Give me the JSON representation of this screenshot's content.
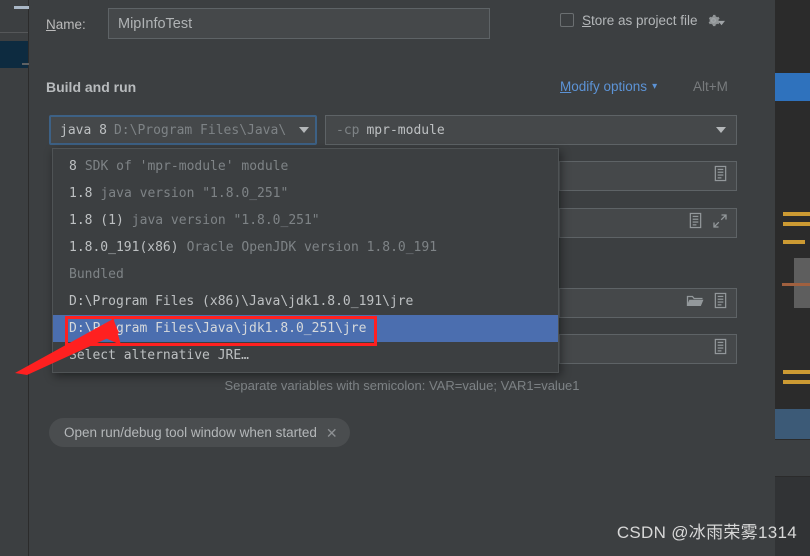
{
  "dialog": {
    "name_label": "Name:",
    "name_value": "MipInfoTest",
    "store_as_project_file": "Store as project file",
    "gear_icon": "gear-icon",
    "section_title": "Build and run",
    "modify_options": "Modify options",
    "modify_options_shortcut": "Alt+M",
    "chevron_icon": "chevron-down-icon"
  },
  "jdk_combo": {
    "name": "java 8",
    "path": "D:\\Program Files\\Java\\",
    "dropdown_icon": "triangle-down-icon"
  },
  "cp_combo": {
    "flag": "-cp",
    "value": "mpr-module",
    "dropdown_icon": "triangle-down-icon"
  },
  "dropdown": {
    "items": [
      {
        "primary": "8",
        "secondary": "SDK of 'mpr-module' module",
        "selected": false,
        "dim": false
      },
      {
        "primary": "1.8",
        "secondary": "java version \"1.8.0_251\"",
        "selected": false,
        "dim": false
      },
      {
        "primary": "1.8 (1)",
        "secondary": "java version \"1.8.0_251\"",
        "selected": false,
        "dim": false
      },
      {
        "primary": "1.8.0_191(x86)",
        "secondary": "Oracle OpenJDK version 1.8.0_191",
        "selected": false,
        "dim": false
      },
      {
        "primary": "Bundled",
        "secondary": "",
        "selected": false,
        "dim": true
      },
      {
        "primary": "D:\\Program Files (x86)\\Java\\jdk1.8.0_191\\jre",
        "secondary": "",
        "selected": false,
        "dim": false
      },
      {
        "primary": "D:\\Program Files\\Java\\jdk1.8.0_251\\jre",
        "secondary": "",
        "selected": true,
        "dim": false
      },
      {
        "primary": "Select alternative JRE…",
        "secondary": "",
        "selected": false,
        "dim": false
      }
    ]
  },
  "hint": "Separate variables with semicolon: VAR=value; VAR1=value1",
  "tag": {
    "label": "Open run/debug tool window when started",
    "close_icon": "close-icon"
  },
  "bg_fields": [
    {
      "icons": [
        "document-icon"
      ]
    },
    {
      "icons": [
        "document-icon",
        "expand-icon"
      ]
    },
    {
      "icons": [
        "folder-icon",
        "document-icon"
      ]
    },
    {
      "icons": [
        "document-icon"
      ]
    }
  ],
  "annotation": {
    "highlight_color": "#ff2020",
    "arrow_icon": "arrow-pointer-icon"
  },
  "watermark": "CSDN @冰雨荣雾1314",
  "colors": {
    "dialog_bg": "#3c3f41",
    "field_bg": "#45484a",
    "selection_blue": "#4b6eaf",
    "link_blue": "#5c93d6",
    "accent_red": "#ff2020"
  }
}
